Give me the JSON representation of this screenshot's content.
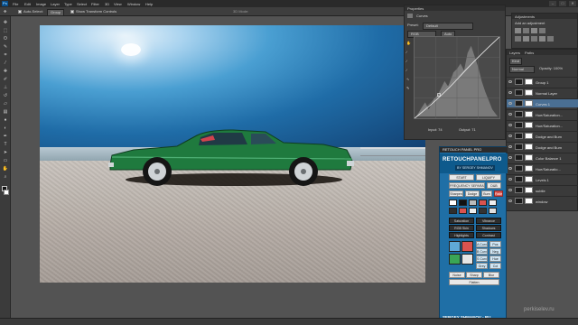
{
  "app": {
    "logo": "Ps"
  },
  "menu": [
    "File",
    "Edit",
    "Image",
    "Layer",
    "Type",
    "Select",
    "Filter",
    "3D",
    "View",
    "Window",
    "Help"
  ],
  "window_controls": [
    "–",
    "□",
    "✕"
  ],
  "options": {
    "auto_select": "Auto-Select:",
    "group": "Group",
    "transform": "Show Transform Controls",
    "mode": "3D Mode:"
  },
  "properties": {
    "title": "Properties",
    "adjustment": "Curves",
    "preset_label": "Preset:",
    "preset_value": "Default",
    "channel": "RGB",
    "input": "Input: 74",
    "output": "Output: 71"
  },
  "adjustments": {
    "title": "Adjustments",
    "add_label": "Add an adjustment"
  },
  "layers": {
    "title": "Layers",
    "tab2": "Paths",
    "kind": "Kind",
    "blend": "Normal",
    "opacity": "Opacity: 100%",
    "items": [
      {
        "name": "Group 1"
      },
      {
        "name": "Normal Layer"
      },
      {
        "name": "Curves 1"
      },
      {
        "name": "Hue/Saturation..."
      },
      {
        "name": "Hue/Saturation..."
      },
      {
        "name": "Dodge and Burn"
      },
      {
        "name": "Dodge and Burn"
      },
      {
        "name": "Color Balance 1"
      },
      {
        "name": "Hue/Saturatio..."
      },
      {
        "name": "Levels 1"
      },
      {
        "name": "subtle"
      },
      {
        "name": "window"
      }
    ]
  },
  "retouch": {
    "header": "RETOUCH PANEL PRO",
    "brand": "RETOUCHPANELPRO",
    "byline": "BY SERGEY SHMANOV",
    "buttons": [
      "START",
      "LIQUIFY",
      "FREQUENCY SEPARATION",
      "D&B",
      "Sharpen",
      "Dodge",
      "Burn",
      "Fade",
      "Saturation",
      "Vibrance",
      "RGB Skin",
      "Shadows",
      "Highlights",
      "Contrast",
      "A Curv",
      "Pos",
      "B Curv",
      "Neg",
      "S Curv",
      "Hue",
      "Grey",
      "Col",
      "Noise",
      "Sharp",
      "Blur",
      "Flatten"
    ],
    "footer": "SERGEY SHMANOV - RU"
  },
  "watermark": "perkiselev.ru",
  "colors": {
    "car": "#1f7a3e",
    "sky": "#2a7ab8",
    "panel": "#1f6fa6"
  }
}
